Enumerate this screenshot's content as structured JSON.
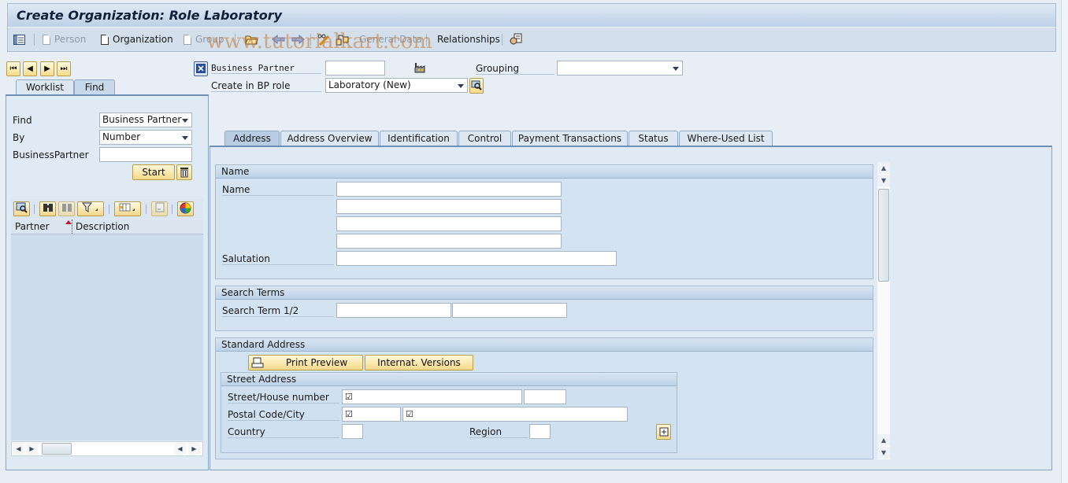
{
  "window": {
    "title": "Create Organization: Role Laboratory",
    "watermark": "www.tutorialkart.com"
  },
  "toolbar": {
    "items": [
      {
        "label": "Person",
        "enabled": false
      },
      {
        "label": "Organization",
        "enabled": true
      },
      {
        "label": "Group",
        "enabled": false
      },
      {
        "label": "General Data",
        "enabled": false
      },
      {
        "label": "Relationships",
        "enabled": true
      }
    ]
  },
  "nav": {
    "first": "⏮",
    "prev": "◀",
    "next": "▶",
    "last": "⏭"
  },
  "left_panel": {
    "tabs": [
      {
        "label": "Worklist",
        "active": false
      },
      {
        "label": "Find",
        "active": true
      }
    ],
    "find_label": "Find",
    "find_value": "Business Partner",
    "by_label": "By",
    "by_value": "Number",
    "bp_label": "BusinessPartner",
    "bp_value": "",
    "start_label": "Start",
    "columns": [
      "Partner",
      "Description"
    ],
    "rows": []
  },
  "header": {
    "bp_label": "Business Partner",
    "bp_value": "",
    "grouping_label": "Grouping",
    "grouping_value": "",
    "role_label": "Create in BP role",
    "role_value": "Laboratory (New)"
  },
  "tabs": [
    {
      "label": "Address",
      "active": true
    },
    {
      "label": "Address Overview",
      "active": false
    },
    {
      "label": "Identification",
      "active": false
    },
    {
      "label": "Control",
      "active": false
    },
    {
      "label": "Payment Transactions",
      "active": false
    },
    {
      "label": "Status",
      "active": false
    },
    {
      "label": "Where-Used List",
      "active": false
    }
  ],
  "name_group": {
    "title": "Name",
    "name_label": "Name",
    "name_values": [
      "",
      "",
      "",
      ""
    ],
    "salutation_label": "Salutation",
    "salutation_value": ""
  },
  "search_group": {
    "title": "Search Terms",
    "label": "Search Term 1/2",
    "values": [
      "",
      ""
    ]
  },
  "address_group": {
    "title": "Standard Address",
    "print_preview": "Print Preview",
    "internat_versions": "Internat. Versions",
    "street_group": {
      "title": "Street Address",
      "street_label": "Street/House number",
      "street_value": "",
      "house_value": "",
      "postal_label": "Postal Code/City",
      "postal_value": "",
      "city_value": "",
      "country_label": "Country",
      "country_value": "",
      "region_label": "Region",
      "region_value": ""
    },
    "required_marker": "☑"
  }
}
